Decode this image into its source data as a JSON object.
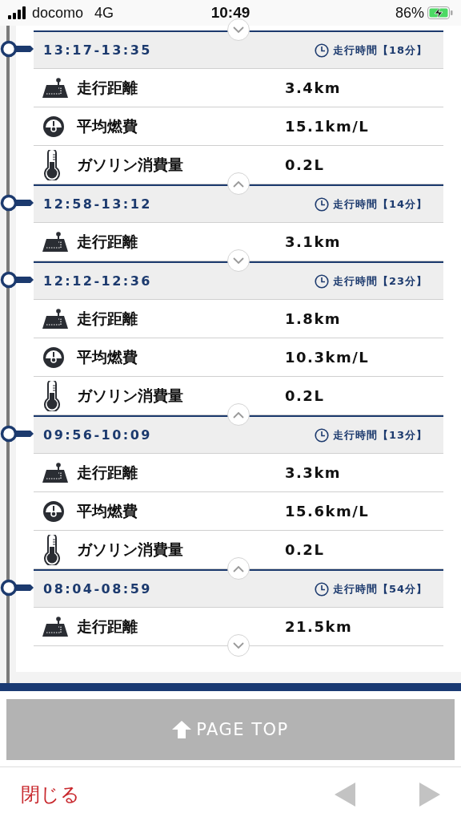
{
  "status_bar": {
    "carrier": "docomo",
    "network": "4G",
    "time": "10:49",
    "battery": "86%",
    "charging": true
  },
  "previous_toggle": {
    "expanded": false
  },
  "trips": [
    {
      "time_range": "13:17-13:35",
      "duration": "走行時間【18分】",
      "expanded": true,
      "rows": [
        {
          "kind": "distance",
          "label": "走行距離",
          "value": "3.4km"
        },
        {
          "kind": "economy",
          "label": "平均燃費",
          "value": "15.1km/L"
        },
        {
          "kind": "fuel",
          "label": "ガソリン消費量",
          "value": "0.2L"
        }
      ]
    },
    {
      "time_range": "12:58-13:12",
      "duration": "走行時間【14分】",
      "expanded": false,
      "rows": [
        {
          "kind": "distance",
          "label": "走行距離",
          "value": "3.1km"
        }
      ]
    },
    {
      "time_range": "12:12-12:36",
      "duration": "走行時間【23分】",
      "expanded": true,
      "rows": [
        {
          "kind": "distance",
          "label": "走行距離",
          "value": "1.8km"
        },
        {
          "kind": "economy",
          "label": "平均燃費",
          "value": "10.3km/L"
        },
        {
          "kind": "fuel",
          "label": "ガソリン消費量",
          "value": "0.2L"
        }
      ]
    },
    {
      "time_range": "09:56-10:09",
      "duration": "走行時間【13分】",
      "expanded": true,
      "rows": [
        {
          "kind": "distance",
          "label": "走行距離",
          "value": "3.3km"
        },
        {
          "kind": "economy",
          "label": "平均燃費",
          "value": "15.6km/L"
        },
        {
          "kind": "fuel",
          "label": "ガソリン消費量",
          "value": "0.2L"
        }
      ]
    },
    {
      "time_range": "08:04-08:59",
      "duration": "走行時間【54分】",
      "expanded": false,
      "rows": [
        {
          "kind": "distance",
          "label": "走行距離",
          "value": "21.5km"
        }
      ]
    }
  ],
  "page_top": "PAGE TOP",
  "footer": {
    "close": "閉じる"
  }
}
